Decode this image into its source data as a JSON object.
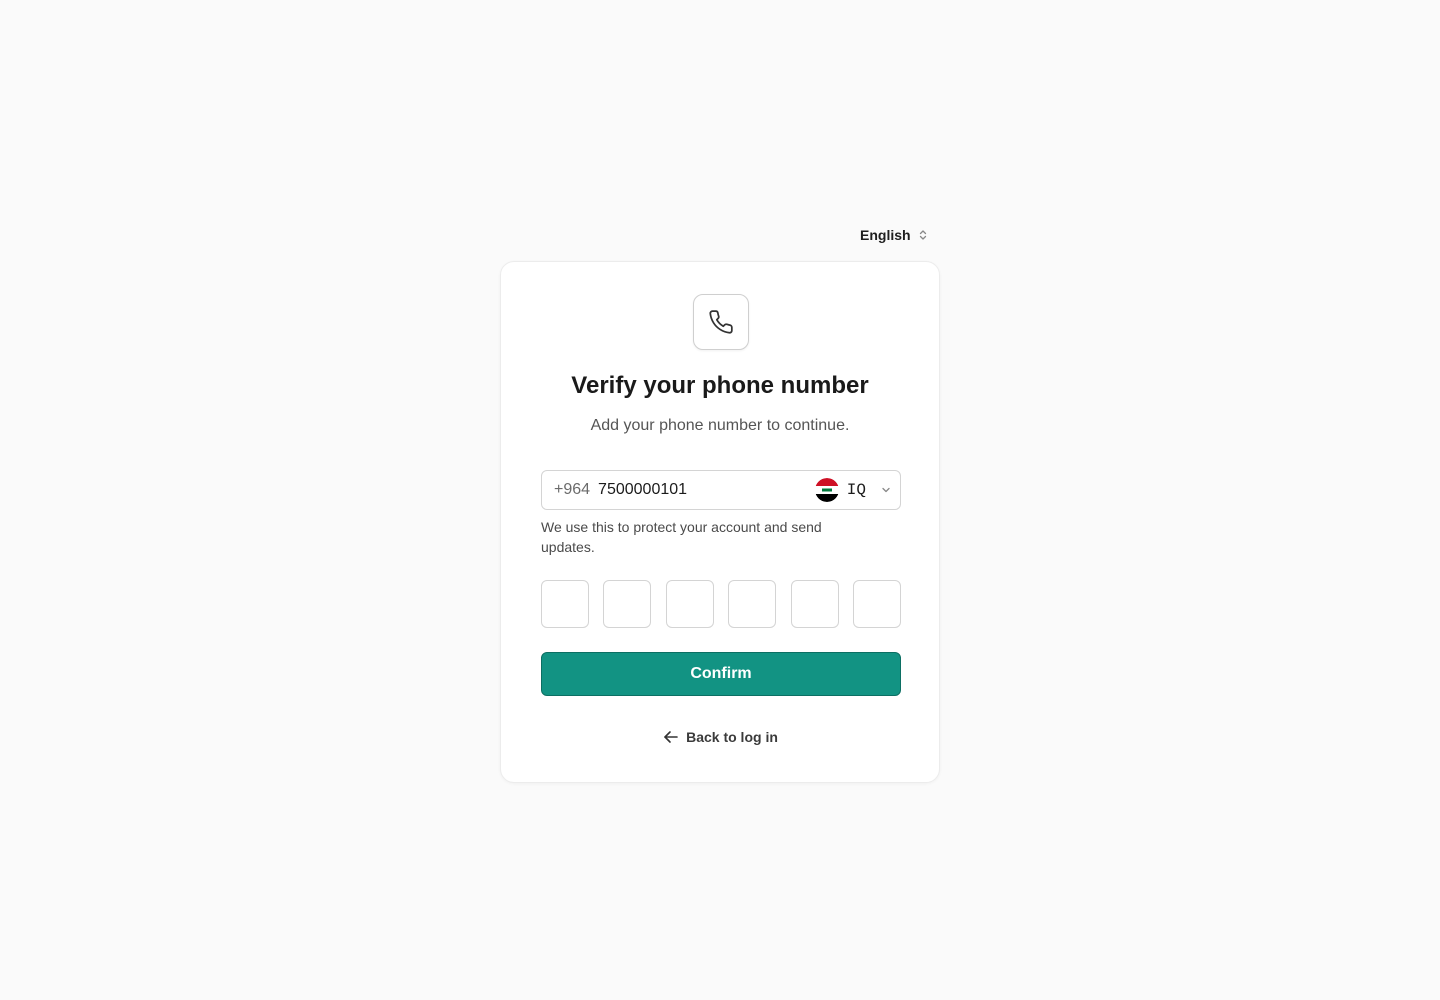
{
  "language": {
    "selected": "English",
    "icon": "chevron-up-down-icon"
  },
  "card": {
    "icon": "phone-icon",
    "title": "Verify your phone number",
    "subtitle": "Add your phone number to continue."
  },
  "phone": {
    "dial_code": "+964",
    "value": "7500000101",
    "placeholder": "",
    "country_code": "IQ",
    "flag_icon": "iraq-flag-icon",
    "helper": "We use this to protect your account and send updates."
  },
  "otp": {
    "digits": [
      "",
      "",
      "",
      "",
      "",
      ""
    ]
  },
  "actions": {
    "confirm_label": "Confirm",
    "back_label": "Back to log in",
    "back_icon": "arrow-left-icon"
  },
  "colors": {
    "primary": "#129383",
    "background": "#fafafa",
    "card": "#ffffff"
  }
}
